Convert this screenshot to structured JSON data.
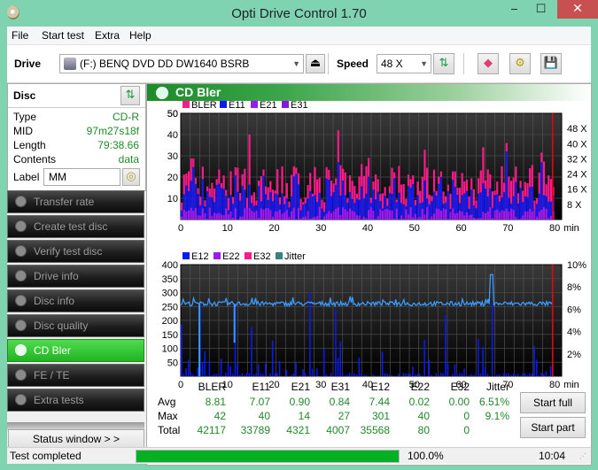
{
  "window": {
    "title": "Opti Drive Control 1.70",
    "minimize": "‒",
    "maximize": "☐",
    "close": "✕"
  },
  "menu": [
    "File",
    "Start test",
    "Extra",
    "Help"
  ],
  "toolbar": {
    "drive_label": "Drive",
    "drive_value": "(F:)  BENQ DVD DD DW1640 BSRB",
    "speed_label": "Speed",
    "speed_value": "48 X"
  },
  "disc": {
    "title": "Disc",
    "fields": [
      {
        "key": "Type",
        "value": "CD-R"
      },
      {
        "key": "MID",
        "value": "97m27s18f"
      },
      {
        "key": "Length",
        "value": "79:38.66"
      },
      {
        "key": "Contents",
        "value": "data"
      }
    ],
    "label_key": "Label",
    "label_value": "MM"
  },
  "nav": [
    {
      "label": "Transfer rate",
      "active": false
    },
    {
      "label": "Create test disc",
      "active": false
    },
    {
      "label": "Verify test disc",
      "active": false
    },
    {
      "label": "Drive info",
      "active": false
    },
    {
      "label": "Disc info",
      "active": false
    },
    {
      "label": "Disc quality",
      "active": false
    },
    {
      "label": "CD Bler",
      "active": true
    },
    {
      "label": "FE / TE",
      "active": false
    },
    {
      "label": "Extra tests",
      "active": false
    }
  ],
  "status_window_button": "Status window > >",
  "panel_title": "CD Bler",
  "colors": {
    "bler": "#ff1a8c",
    "e11": "#0a1af0",
    "e21": "#9a1af0",
    "e31": "#8a14e0",
    "e12": "#0a1af0",
    "e22": "#9a1af0",
    "e32": "#ff1a8c",
    "jitter": "#3a9aff",
    "jitter_legend": "#3a8080",
    "accent": "#22b322"
  },
  "chart_data": [
    {
      "type": "bar",
      "title": "CD Bler upper",
      "legend": [
        "BLER",
        "E11",
        "E21",
        "E31"
      ],
      "legend_placement": "top-left",
      "xlabel": "min",
      "x_ticks": [
        "0",
        "10",
        "20",
        "30",
        "40",
        "50",
        "60",
        "70",
        "80"
      ],
      "xlim": [
        0,
        80
      ],
      "y_ticks": [
        "10",
        "20",
        "30",
        "40",
        "50"
      ],
      "ylim": [
        0,
        50
      ],
      "y2_ticks": [
        "8 X",
        "16 X",
        "24 X",
        "32 X",
        "40 X",
        "48 X"
      ],
      "y2lim": [
        0,
        56
      ],
      "series_summary": {
        "BLER": {
          "avg": 8.81,
          "max": 42
        },
        "E11": {
          "avg": 7.07,
          "max": 40
        },
        "E21": {
          "avg": 0.9,
          "max": 14
        },
        "E31": {
          "avg": 0.84,
          "max": 27
        }
      },
      "notable_peaks": [
        {
          "x": 14.5,
          "BLER": 40
        },
        {
          "x": 33.5,
          "BLER": 42
        },
        {
          "x": 64.5,
          "BLER": 34
        },
        {
          "x": 69.5,
          "BLER": 36
        }
      ]
    },
    {
      "type": "bar",
      "title": "CD Bler lower",
      "legend": [
        "E12",
        "E22",
        "E32",
        "Jitter"
      ],
      "legend_placement": "top-left",
      "xlabel": "min",
      "x_ticks": [
        "0",
        "10",
        "20",
        "30",
        "40",
        "50",
        "60",
        "70",
        "80"
      ],
      "xlim": [
        0,
        80
      ],
      "y_ticks": [
        "50",
        "100",
        "150",
        "200",
        "250",
        "300",
        "350",
        "400"
      ],
      "ylim": [
        0,
        400
      ],
      "y2_ticks": [
        "2%",
        "4%",
        "6%",
        "8%",
        "10%"
      ],
      "y2lim": [
        0,
        10
      ],
      "jitter_baseline_percent": 6.5,
      "jitter_peak": {
        "x": 66.5,
        "value_percent": 9.1
      },
      "e12_peaks": [
        {
          "x": 4,
          "value": 260
        },
        {
          "x": 11.5,
          "value": 250
        },
        {
          "x": 27.5,
          "value": 301
        },
        {
          "x": 33,
          "value": 240
        },
        {
          "x": 56.5,
          "value": 220
        },
        {
          "x": 66.5,
          "value": 260
        }
      ]
    }
  ],
  "stats": {
    "columns": [
      "BLER",
      "E11",
      "E21",
      "E31",
      "E12",
      "E22",
      "E32",
      "Jitter"
    ],
    "rows": [
      {
        "label": "Avg",
        "values": [
          "8.81",
          "7.07",
          "0.90",
          "0.84",
          "7.44",
          "0.02",
          "0.00",
          "6.51%"
        ]
      },
      {
        "label": "Max",
        "values": [
          "42",
          "40",
          "14",
          "27",
          "301",
          "40",
          "0",
          "9.1%"
        ]
      },
      {
        "label": "Total",
        "values": [
          "42117",
          "33789",
          "4321",
          "4007",
          "35568",
          "80",
          "0",
          ""
        ]
      }
    ]
  },
  "buttons": {
    "start_full": "Start full",
    "start_part": "Start part"
  },
  "statusbar": {
    "message": "Test completed",
    "progress_percent": 100,
    "progress_text": "100.0%",
    "time": "10:04"
  }
}
